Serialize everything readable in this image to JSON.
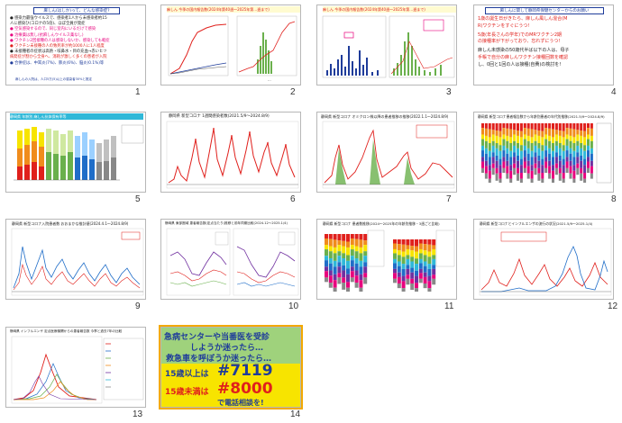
{
  "colors": {
    "red": "#e0201c",
    "magenta": "#e8007d",
    "blue": "#1f3c9a",
    "cyan_bg": "#2fb8d8",
    "green_bg": "#9fd27c",
    "yellow": "#f7e400",
    "orange_band": "#f08c1c"
  },
  "slides": [
    {
      "num": "1",
      "title": "麻しん(はしか)って、どんな感染症?",
      "lines": [
        "● 感染力最強ウイルスで、感染者1人から未感染者約15",
        "  人に感染ひ(コロナの5倍)、ほぼ全員が発症",
        "● 空気感染するので、同じ室内にいるだけで感染",
        "● 治療薬は無し(抗麻しんウイルス薬なし)",
        "● ワクチン2回接種の人は感染しないか、感染しても軽症",
        "● ワクチン未接種の人の致死率が約1000人に1人程度",
        "● 未接種者の症状は高熱・咳鼻水・目の充血→赤いヒツ",
        "  病発症が割から全身へ、消耗が激しく多くの患者が入院",
        "● 合併症は、中耳炎(7%)、肺炎(6%)、脳炎(0.1%)等"
      ],
      "footer": "麻しんの入院は、人口5万(5)以上の感染者30%と推定"
    },
    {
      "num": "2",
      "title": "麻しん 今季の国内報告数(2024年第40週〜2025年第…週まで)"
    },
    {
      "num": "3",
      "title": "麻しん 今季の国内報告数(2024年第40週〜2025年第…週まで)"
    },
    {
      "num": "4",
      "title": "麻しんに関して静岡県保健センターからのお願い",
      "lines": [
        "1歳の誕生日がきたら、麻しん風しん混合(M",
        "R)ワクチンをすぐにうつ!",
        "5歳(年長さんの学年)でのMRワクチン2期",
        "の接種率が下がっており、忘れずにうつ!",
        "麻しん未感染の50歳代半ば以下の人は、母子",
        "手帳で自分の麻しんワクチン接種回数を確認",
        "し、0回と1回の人は接種(自費)の検討を!"
      ]
    },
    {
      "num": "5",
      "title": "静岡県 年齢別 麻しん抗体保有率等"
    },
    {
      "num": "6",
      "title": "静岡県 新型コロナ 1週間感染者数(2021.5/9〜2024.8/9)"
    },
    {
      "num": "7",
      "title": "静岡県 新型コロナ オミクロン株以降の患者推移の推移(2022.1.1〜2024.8/9)"
    },
    {
      "num": "8",
      "title": "静岡県 新型コロナ患者報告数から年齢別患者の年代別推移(2021.5/9〜2024.8/9)"
    },
    {
      "num": "9",
      "title": "静岡県 新型コロナ入院患者数 おおまかな推計値(2024.4.1〜2024.8/9)"
    },
    {
      "num": "10",
      "title": "静岡県 東部圏域 患者報告数(定点当たり)推移と前年同期比較(2024.12〜2025.1/4)"
    },
    {
      "num": "11",
      "title": "静岡県 新型コロナ 患者数推移(2024〜2025年の年齢別推移・3週ごと比較)"
    },
    {
      "num": "12",
      "title": "静岡県 新型コロナとインフルエンザの流行の状況(2021.5/9〜2025.1/4)"
    },
    {
      "num": "13",
      "title": "静岡県 インフルエンザ 定点医療機関からの患者報告数 今季と過去7年の比較"
    },
    {
      "num": "14",
      "line1": "急病センターや当番医を受診",
      "line2": "しようか迷ったら…",
      "line3": "救急車を呼ぼうか迷ったら…",
      "line4a": "15歳以上は",
      "line4b": "#7119",
      "line5a": "15歳未満は",
      "line5b": "#8000",
      "line6": "で電話相談を!"
    }
  ]
}
